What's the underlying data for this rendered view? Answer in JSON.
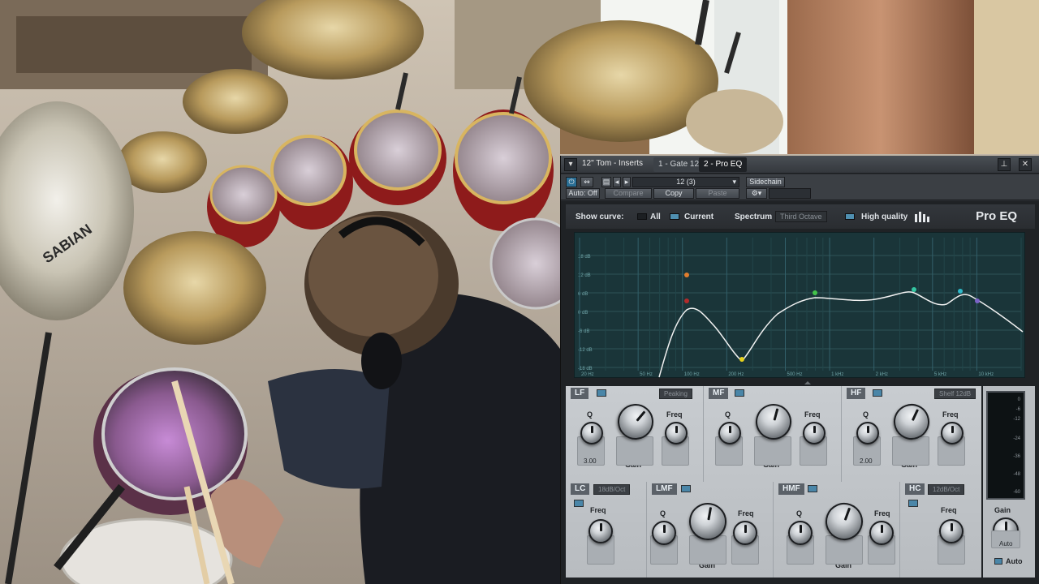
{
  "window": {
    "track_title": "12\" Tom - Inserts",
    "tabs": [
      "1 - Gate 12",
      "2 - Pro EQ"
    ],
    "active_tab": 1
  },
  "toolbar": {
    "auto_label": "Auto: Off",
    "preset_value": "12 (3)",
    "compare_label": "Compare",
    "copy_label": "Copy",
    "paste_label": "Paste",
    "sidechain_label": "Sidechain"
  },
  "header": {
    "show_curve_label": "Show curve:",
    "all_label": "All",
    "current_label": "Current",
    "spectrum_label": "Spectrum",
    "spectrum_mode": "Third Octave",
    "high_quality_label": "High quality",
    "brand": "Pro EQ"
  },
  "graph": {
    "db_labels": [
      "18 dB",
      "12 dB",
      "6 dB",
      "0 dB",
      "-6 dB",
      "-12 dB",
      "-18 dB"
    ],
    "freq_labels": [
      "20 Hz",
      "50 Hz",
      "100 Hz",
      "200 Hz",
      "500 Hz",
      "1 kHz",
      "2 kHz",
      "5 kHz",
      "10 kHz"
    ]
  },
  "bands_top": [
    {
      "name": "LF",
      "mode": "Peaking",
      "q_label": "Q",
      "gain_label": "Gain",
      "freq_label": "Freq",
      "q_value": "3.00"
    },
    {
      "name": "MF",
      "q_label": "Q",
      "gain_label": "Gain",
      "freq_label": "Freq"
    },
    {
      "name": "HF",
      "mode": "Shelf 12dB",
      "q_label": "Q",
      "gain_label": "Gain",
      "freq_label": "Freq",
      "q_value": "2.00"
    }
  ],
  "bands_bottom": [
    {
      "name": "LC",
      "mode": "18dB/Oct",
      "freq_label": "Freq"
    },
    {
      "name": "LMF",
      "q_label": "Q",
      "gain_label": "Gain",
      "freq_label": "Freq"
    },
    {
      "name": "HMF",
      "q_label": "Q",
      "gain_label": "Gain",
      "freq_label": "Freq"
    },
    {
      "name": "HC",
      "mode": "12dB/Oct",
      "freq_label": "Freq"
    }
  ],
  "output": {
    "gain_label": "Gain",
    "auto_value": "Auto",
    "auto_toggle_label": "Auto",
    "scale": [
      "0",
      "-6",
      "-12",
      "-24",
      "-36",
      "-48",
      "-60"
    ]
  }
}
